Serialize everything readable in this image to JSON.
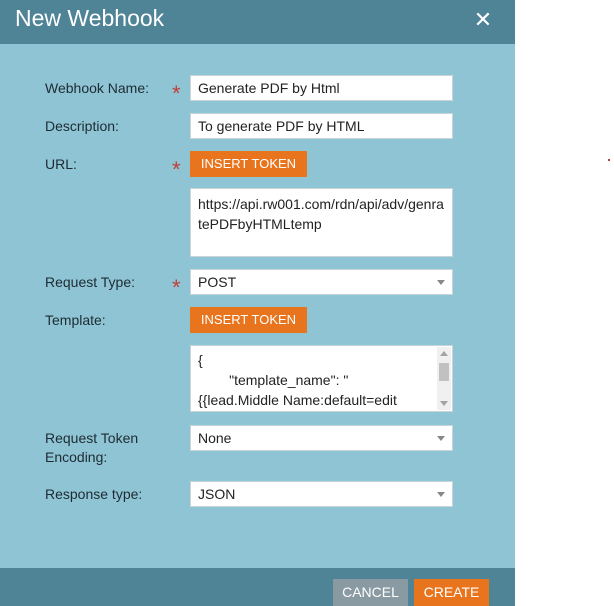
{
  "dialog": {
    "title": "New Webhook",
    "close_icon": "close-icon"
  },
  "form": {
    "required_mark": "*",
    "webhook_name": {
      "label": "Webhook Name:",
      "value": "Generate PDF by Html"
    },
    "description": {
      "label": "Description:",
      "value": "To generate PDF by HTML"
    },
    "url": {
      "label": "URL:",
      "token_button": "INSERT TOKEN",
      "value": "https://api.rw001.com/rdn/api/adv/genratePDFbyHTMLtemp"
    },
    "request_type": {
      "label": "Request Type:",
      "value": "POST"
    },
    "template": {
      "label": "Template:",
      "token_button": "INSERT TOKEN",
      "value": "{\n        \"template_name\": \"\n{{lead.Middle Name:default=edit\n        \"\","
    },
    "request_token_encoding": {
      "label": "Request Token\nEncoding:",
      "value": "None"
    },
    "response_type": {
      "label": "Response type:",
      "value": "JSON"
    }
  },
  "footer": {
    "cancel_label": "CANCEL",
    "create_label": "CREATE"
  },
  "colors": {
    "titlebar": "#4f8396",
    "body": "#8ec4d4",
    "accent": "#e8751d",
    "required": "#c0413b",
    "cancel": "#8a9aa3"
  }
}
